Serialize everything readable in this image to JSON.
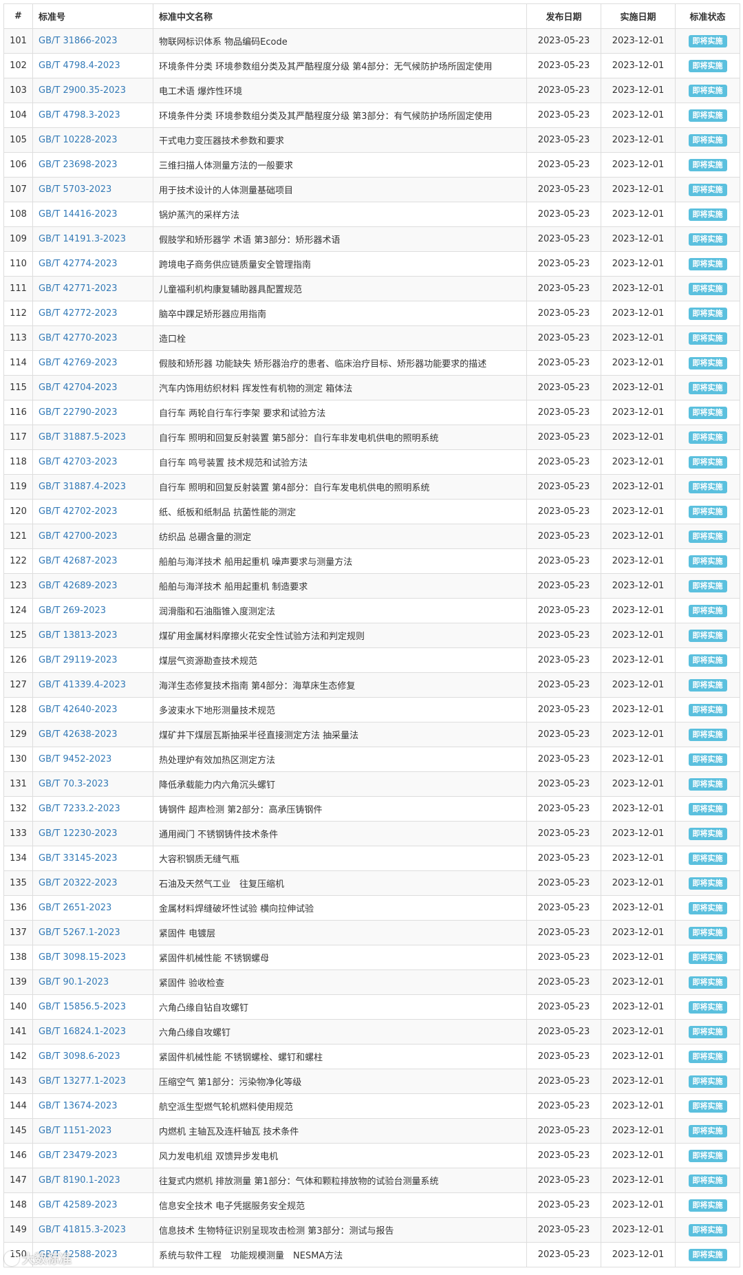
{
  "table": {
    "headers": {
      "num": "#",
      "code": "标准号",
      "name": "标准中文名称",
      "publish": "发布日期",
      "implement": "实施日期",
      "status": "标准状态"
    },
    "rows": [
      {
        "num": "101",
        "code": "GB/T 31866-2023",
        "name": "物联网标识体系 物品编码Ecode",
        "publish": "2023-05-23",
        "implement": "2023-12-01",
        "status": "即将实施"
      },
      {
        "num": "102",
        "code": "GB/T 4798.4-2023",
        "name": "环境条件分类 环境参数组分类及其严酷程度分级 第4部分：无气候防护场所固定使用",
        "publish": "2023-05-23",
        "implement": "2023-12-01",
        "status": "即将实施"
      },
      {
        "num": "103",
        "code": "GB/T 2900.35-2023",
        "name": "电工术语 爆炸性环境",
        "publish": "2023-05-23",
        "implement": "2023-12-01",
        "status": "即将实施"
      },
      {
        "num": "104",
        "code": "GB/T 4798.3-2023",
        "name": "环境条件分类 环境参数组分类及其严酷程度分级 第3部分：有气候防护场所固定使用",
        "publish": "2023-05-23",
        "implement": "2023-12-01",
        "status": "即将实施"
      },
      {
        "num": "105",
        "code": "GB/T 10228-2023",
        "name": "干式电力变压器技术参数和要求",
        "publish": "2023-05-23",
        "implement": "2023-12-01",
        "status": "即将实施"
      },
      {
        "num": "106",
        "code": "GB/T 23698-2023",
        "name": "三维扫描人体测量方法的一般要求",
        "publish": "2023-05-23",
        "implement": "2023-12-01",
        "status": "即将实施"
      },
      {
        "num": "107",
        "code": "GB/T 5703-2023",
        "name": "用于技术设计的人体测量基础项目",
        "publish": "2023-05-23",
        "implement": "2023-12-01",
        "status": "即将实施"
      },
      {
        "num": "108",
        "code": "GB/T 14416-2023",
        "name": "锅炉蒸汽的采样方法",
        "publish": "2023-05-23",
        "implement": "2023-12-01",
        "status": "即将实施"
      },
      {
        "num": "109",
        "code": "GB/T 14191.3-2023",
        "name": "假肢学和矫形器学 术语 第3部分：矫形器术语",
        "publish": "2023-05-23",
        "implement": "2023-12-01",
        "status": "即将实施"
      },
      {
        "num": "110",
        "code": "GB/T 42774-2023",
        "name": "跨境电子商务供应链质量安全管理指南",
        "publish": "2023-05-23",
        "implement": "2023-12-01",
        "status": "即将实施"
      },
      {
        "num": "111",
        "code": "GB/T 42771-2023",
        "name": "儿童福利机构康复辅助器具配置规范",
        "publish": "2023-05-23",
        "implement": "2023-12-01",
        "status": "即将实施"
      },
      {
        "num": "112",
        "code": "GB/T 42772-2023",
        "name": "脑卒中踝足矫形器应用指南",
        "publish": "2023-05-23",
        "implement": "2023-12-01",
        "status": "即将实施"
      },
      {
        "num": "113",
        "code": "GB/T 42770-2023",
        "name": "造口栓",
        "publish": "2023-05-23",
        "implement": "2023-12-01",
        "status": "即将实施"
      },
      {
        "num": "114",
        "code": "GB/T 42769-2023",
        "name": "假肢和矫形器 功能缺失 矫形器治疗的患者、临床治疗目标、矫形器功能要求的描述",
        "publish": "2023-05-23",
        "implement": "2023-12-01",
        "status": "即将实施"
      },
      {
        "num": "115",
        "code": "GB/T 42704-2023",
        "name": "汽车内饰用纺织材料 挥发性有机物的测定 箱体法",
        "publish": "2023-05-23",
        "implement": "2023-12-01",
        "status": "即将实施"
      },
      {
        "num": "116",
        "code": "GB/T 22790-2023",
        "name": "自行车 两轮自行车行李架 要求和试验方法",
        "publish": "2023-05-23",
        "implement": "2023-12-01",
        "status": "即将实施"
      },
      {
        "num": "117",
        "code": "GB/T 31887.5-2023",
        "name": "自行车 照明和回复反射装置 第5部分：自行车非发电机供电的照明系统",
        "publish": "2023-05-23",
        "implement": "2023-12-01",
        "status": "即将实施"
      },
      {
        "num": "118",
        "code": "GB/T 42703-2023",
        "name": "自行车 鸣号装置 技术规范和试验方法",
        "publish": "2023-05-23",
        "implement": "2023-12-01",
        "status": "即将实施"
      },
      {
        "num": "119",
        "code": "GB/T 31887.4-2023",
        "name": "自行车 照明和回复反射装置 第4部分：自行车发电机供电的照明系统",
        "publish": "2023-05-23",
        "implement": "2023-12-01",
        "status": "即将实施"
      },
      {
        "num": "120",
        "code": "GB/T 42702-2023",
        "name": "纸、纸板和纸制品 抗菌性能的测定",
        "publish": "2023-05-23",
        "implement": "2023-12-01",
        "status": "即将实施"
      },
      {
        "num": "121",
        "code": "GB/T 42700-2023",
        "name": "纺织品 总硼含量的测定",
        "publish": "2023-05-23",
        "implement": "2023-12-01",
        "status": "即将实施"
      },
      {
        "num": "122",
        "code": "GB/T 42687-2023",
        "name": "船舶与海洋技术 船用起重机 噪声要求与测量方法",
        "publish": "2023-05-23",
        "implement": "2023-12-01",
        "status": "即将实施"
      },
      {
        "num": "123",
        "code": "GB/T 42689-2023",
        "name": "船舶与海洋技术 船用起重机 制造要求",
        "publish": "2023-05-23",
        "implement": "2023-12-01",
        "status": "即将实施"
      },
      {
        "num": "124",
        "code": "GB/T 269-2023",
        "name": "润滑脂和石油脂锥入度测定法",
        "publish": "2023-05-23",
        "implement": "2023-12-01",
        "status": "即将实施"
      },
      {
        "num": "125",
        "code": "GB/T 13813-2023",
        "name": "煤矿用金属材料摩擦火花安全性试验方法和判定规则",
        "publish": "2023-05-23",
        "implement": "2023-12-01",
        "status": "即将实施"
      },
      {
        "num": "126",
        "code": "GB/T 29119-2023",
        "name": "煤层气资源勘查技术规范",
        "publish": "2023-05-23",
        "implement": "2023-12-01",
        "status": "即将实施"
      },
      {
        "num": "127",
        "code": "GB/T 41339.4-2023",
        "name": "海洋生态修复技术指南 第4部分：海草床生态修复",
        "publish": "2023-05-23",
        "implement": "2023-12-01",
        "status": "即将实施"
      },
      {
        "num": "128",
        "code": "GB/T 42640-2023",
        "name": "多波束水下地形测量技术规范",
        "publish": "2023-05-23",
        "implement": "2023-12-01",
        "status": "即将实施"
      },
      {
        "num": "129",
        "code": "GB/T 42638-2023",
        "name": "煤矿井下煤层瓦斯抽采半径直接测定方法 抽采量法",
        "publish": "2023-05-23",
        "implement": "2023-12-01",
        "status": "即将实施"
      },
      {
        "num": "130",
        "code": "GB/T 9452-2023",
        "name": "热处理炉有效加热区测定方法",
        "publish": "2023-05-23",
        "implement": "2023-12-01",
        "status": "即将实施"
      },
      {
        "num": "131",
        "code": "GB/T 70.3-2023",
        "name": "降低承载能力内六角沉头螺钉",
        "publish": "2023-05-23",
        "implement": "2023-12-01",
        "status": "即将实施"
      },
      {
        "num": "132",
        "code": "GB/T 7233.2-2023",
        "name": "铸钢件 超声检测 第2部分：高承压铸钢件",
        "publish": "2023-05-23",
        "implement": "2023-12-01",
        "status": "即将实施"
      },
      {
        "num": "133",
        "code": "GB/T 12230-2023",
        "name": "通用阀门 不锈钢铸件技术条件",
        "publish": "2023-05-23",
        "implement": "2023-12-01",
        "status": "即将实施"
      },
      {
        "num": "134",
        "code": "GB/T 33145-2023",
        "name": "大容积钢质无缝气瓶",
        "publish": "2023-05-23",
        "implement": "2023-12-01",
        "status": "即将实施"
      },
      {
        "num": "135",
        "code": "GB/T 20322-2023",
        "name": "石油及天然气工业　往复压缩机",
        "publish": "2023-05-23",
        "implement": "2023-12-01",
        "status": "即将实施"
      },
      {
        "num": "136",
        "code": "GB/T 2651-2023",
        "name": "金属材料焊缝破坏性试验 横向拉伸试验",
        "publish": "2023-05-23",
        "implement": "2023-12-01",
        "status": "即将实施"
      },
      {
        "num": "137",
        "code": "GB/T 5267.1-2023",
        "name": "紧固件 电镀层",
        "publish": "2023-05-23",
        "implement": "2023-12-01",
        "status": "即将实施"
      },
      {
        "num": "138",
        "code": "GB/T 3098.15-2023",
        "name": "紧固件机械性能 不锈钢螺母",
        "publish": "2023-05-23",
        "implement": "2023-12-01",
        "status": "即将实施"
      },
      {
        "num": "139",
        "code": "GB/T 90.1-2023",
        "name": "紧固件 验收检查",
        "publish": "2023-05-23",
        "implement": "2023-12-01",
        "status": "即将实施"
      },
      {
        "num": "140",
        "code": "GB/T 15856.5-2023",
        "name": "六角凸缘自钻自攻螺钉",
        "publish": "2023-05-23",
        "implement": "2023-12-01",
        "status": "即将实施"
      },
      {
        "num": "141",
        "code": "GB/T 16824.1-2023",
        "name": "六角凸缘自攻螺钉",
        "publish": "2023-05-23",
        "implement": "2023-12-01",
        "status": "即将实施"
      },
      {
        "num": "142",
        "code": "GB/T 3098.6-2023",
        "name": "紧固件机械性能 不锈钢螺栓、螺钉和螺柱",
        "publish": "2023-05-23",
        "implement": "2023-12-01",
        "status": "即将实施"
      },
      {
        "num": "143",
        "code": "GB/T 13277.1-2023",
        "name": "压缩空气 第1部分：污染物净化等级",
        "publish": "2023-05-23",
        "implement": "2023-12-01",
        "status": "即将实施"
      },
      {
        "num": "144",
        "code": "GB/T 13674-2023",
        "name": "航空派生型燃气轮机燃料使用规范",
        "publish": "2023-05-23",
        "implement": "2023-12-01",
        "status": "即将实施"
      },
      {
        "num": "145",
        "code": "GB/T 1151-2023",
        "name": "内燃机 主轴瓦及连杆轴瓦 技术条件",
        "publish": "2023-05-23",
        "implement": "2023-12-01",
        "status": "即将实施"
      },
      {
        "num": "146",
        "code": "GB/T 23479-2023",
        "name": "风力发电机组 双馈异步发电机",
        "publish": "2023-05-23",
        "implement": "2023-12-01",
        "status": "即将实施"
      },
      {
        "num": "147",
        "code": "GB/T 8190.1-2023",
        "name": "往复式内燃机 排放测量 第1部分：气体和颗粒排放物的试验台测量系统",
        "publish": "2023-05-23",
        "implement": "2023-12-01",
        "status": "即将实施"
      },
      {
        "num": "148",
        "code": "GB/T 42589-2023",
        "name": "信息安全技术 电子凭据服务安全规范",
        "publish": "2023-05-23",
        "implement": "2023-12-01",
        "status": "即将实施"
      },
      {
        "num": "149",
        "code": "GB/T 41815.3-2023",
        "name": "信息技术 生物特征识别呈现攻击检测 第3部分：测试与报告",
        "publish": "2023-05-23",
        "implement": "2023-12-01",
        "status": "即将实施"
      },
      {
        "num": "150",
        "code": "GB/T 42588-2023",
        "name": "系统与软件工程　功能规模测量　NESMA方法",
        "publish": "2023-05-23",
        "implement": "2023-12-01",
        "status": "即将实施"
      }
    ]
  },
  "watermark": {
    "text": "大数标准",
    "icon": "watermark-logo-icon"
  },
  "colors": {
    "link": "#337ab7",
    "badge": "#5bc0de",
    "border": "#dddddd",
    "stripe": "#f9f9f9"
  }
}
